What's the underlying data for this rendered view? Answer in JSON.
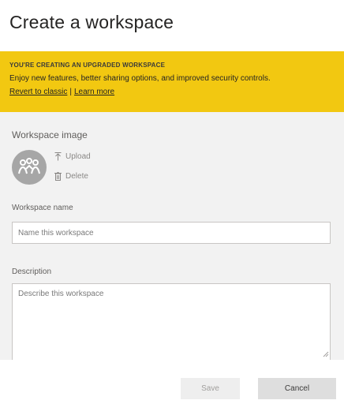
{
  "dialog": {
    "title": "Create a workspace"
  },
  "banner": {
    "heading": "You're creating an upgraded workspace",
    "text": "Enjoy new features, better sharing options, and improved security controls.",
    "revert_link": "Revert to classic",
    "separator": "|",
    "learn_more_link": "Learn more",
    "background_color": "#f2c811"
  },
  "workspace_image": {
    "label": "Workspace image",
    "avatar_icon": "people-network-icon",
    "upload_label": "Upload",
    "upload_icon": "upload-icon",
    "delete_label": "Delete",
    "delete_icon": "trash-icon"
  },
  "workspace_name": {
    "label": "Workspace name",
    "placeholder": "Name this workspace",
    "value": ""
  },
  "description": {
    "label": "Description",
    "placeholder": "Describe this workspace",
    "value": ""
  },
  "footer": {
    "save_label": "Save",
    "cancel_label": "Cancel"
  }
}
